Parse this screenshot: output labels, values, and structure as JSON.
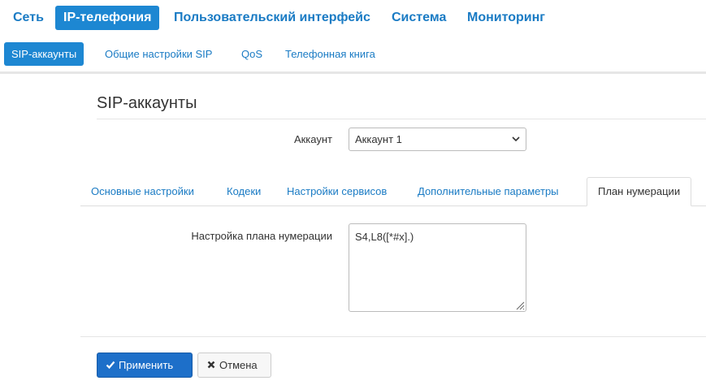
{
  "top_nav": {
    "items": [
      {
        "label": "Сеть",
        "active": false
      },
      {
        "label": "IP-телефония",
        "active": true
      },
      {
        "label": "Пользовательский интерфейс",
        "active": false
      },
      {
        "label": "Система",
        "active": false
      },
      {
        "label": "Мониторинг",
        "active": false
      }
    ]
  },
  "sub_nav": {
    "items": [
      {
        "label": "SIP-аккаунты",
        "active": true
      },
      {
        "label": "Общие настройки SIP",
        "active": false
      },
      {
        "label": "QoS",
        "active": false
      },
      {
        "label": "Телефонная книга",
        "active": false
      }
    ]
  },
  "page": {
    "title": "SIP-аккаунты"
  },
  "account": {
    "label": "Аккаунт",
    "selected": "Аккаунт 1"
  },
  "tabs": [
    {
      "label": "Основные настройки",
      "active": false
    },
    {
      "label": "Кодеки",
      "active": false
    },
    {
      "label": "Настройки сервисов",
      "active": false
    },
    {
      "label": "Дополнительные параметры",
      "active": false
    },
    {
      "label": "План нумерации",
      "active": true
    }
  ],
  "dial_plan": {
    "label": "Настройка плана нумерации",
    "value": "S4,L8([*#x].)"
  },
  "actions": {
    "apply_label": "Применить",
    "cancel_label": "Отмена"
  },
  "colors": {
    "accent": "#1d87d2",
    "link": "#1a7bc4",
    "primary_button": "#1d6fc9"
  },
  "icons": {
    "apply": "check-icon",
    "cancel": "times-icon",
    "select": "chevron-down-icon",
    "resize": "resize-grip-icon"
  }
}
